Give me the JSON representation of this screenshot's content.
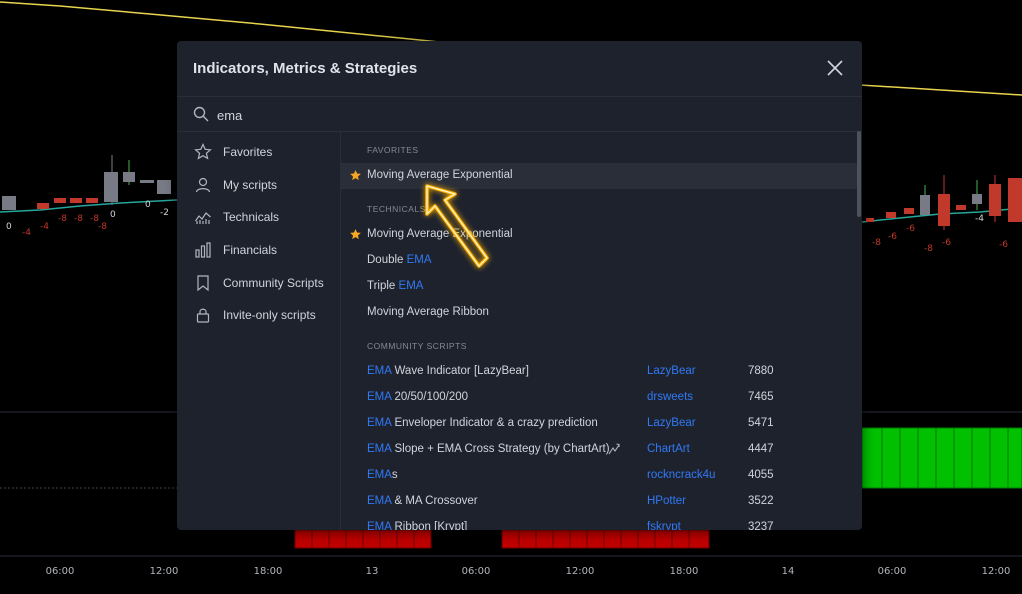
{
  "modal": {
    "title": "Indicators, Metrics & Strategies",
    "search_value": "ema"
  },
  "sidebar": {
    "items": [
      {
        "label": "Favorites",
        "icon": "star-outline-icon"
      },
      {
        "label": "My scripts",
        "icon": "user-icon"
      },
      {
        "label": "Technicals",
        "icon": "technicals-chart-icon"
      },
      {
        "label": "Financials",
        "icon": "bar-chart-icon"
      },
      {
        "label": "Community Scripts",
        "icon": "bookmark-icon"
      },
      {
        "label": "Invite-only scripts",
        "icon": "lock-icon"
      }
    ]
  },
  "results": {
    "favorites_header": "FAVORITES",
    "favorites": [
      {
        "name": "Moving Average Exponential",
        "starred": true
      }
    ],
    "technicals_header": "TECHNICALS",
    "technicals": [
      {
        "prefix": "",
        "highlight": "",
        "suffix": "Moving Average Exponential",
        "starred": true
      },
      {
        "prefix": "Double ",
        "highlight": "EMA",
        "suffix": "",
        "starred": false
      },
      {
        "prefix": "Triple ",
        "highlight": "EMA",
        "suffix": "",
        "starred": false
      },
      {
        "prefix": "Moving Average Ribbon",
        "highlight": "",
        "suffix": "",
        "starred": false
      }
    ],
    "community_header": "COMMUNITY SCRIPTS",
    "community": [
      {
        "highlight": "EMA",
        "suffix": " Wave Indicator [LazyBear]",
        "author": "LazyBear",
        "count": "7880"
      },
      {
        "highlight": "EMA",
        "suffix": " 20/50/100/200",
        "author": "drsweets",
        "count": "7465"
      },
      {
        "highlight": "EMA",
        "suffix": " Enveloper Indicator & a crazy prediction",
        "author": "LazyBear",
        "count": "5471"
      },
      {
        "highlight": "EMA",
        "suffix": " Slope + EMA Cross Strategy (by ChartArt)",
        "author": "ChartArt",
        "count": "4447",
        "strategy_icon": true
      },
      {
        "highlight": "EMA",
        "suffix": "s",
        "author": "rockncrack4u",
        "count": "4055"
      },
      {
        "highlight": "EMA",
        "suffix": " & MA Crossover",
        "author": "HPotter",
        "count": "3522"
      },
      {
        "highlight": "EMA",
        "suffix": " Ribbon [Krypt]",
        "author": "fskrypt",
        "count": "3237"
      }
    ]
  },
  "chart": {
    "time_labels": [
      "06:00",
      "12:00",
      "18:00",
      "13",
      "06:00",
      "12:00",
      "18:00",
      "14",
      "06:00",
      "12:00"
    ],
    "left_values": [
      "0",
      "-4",
      "-4",
      "-8",
      "-8",
      "-8",
      "-8",
      "0",
      "0",
      "-2"
    ],
    "right_values": [
      "-8",
      "-6",
      "-6",
      "-8",
      "-6",
      "-4",
      "-6"
    ]
  },
  "colors": {
    "accent": "#3179f5",
    "star": "#f5a623",
    "up": "#4caf50",
    "down": "#c0392b",
    "arrow": "#ffb300"
  }
}
